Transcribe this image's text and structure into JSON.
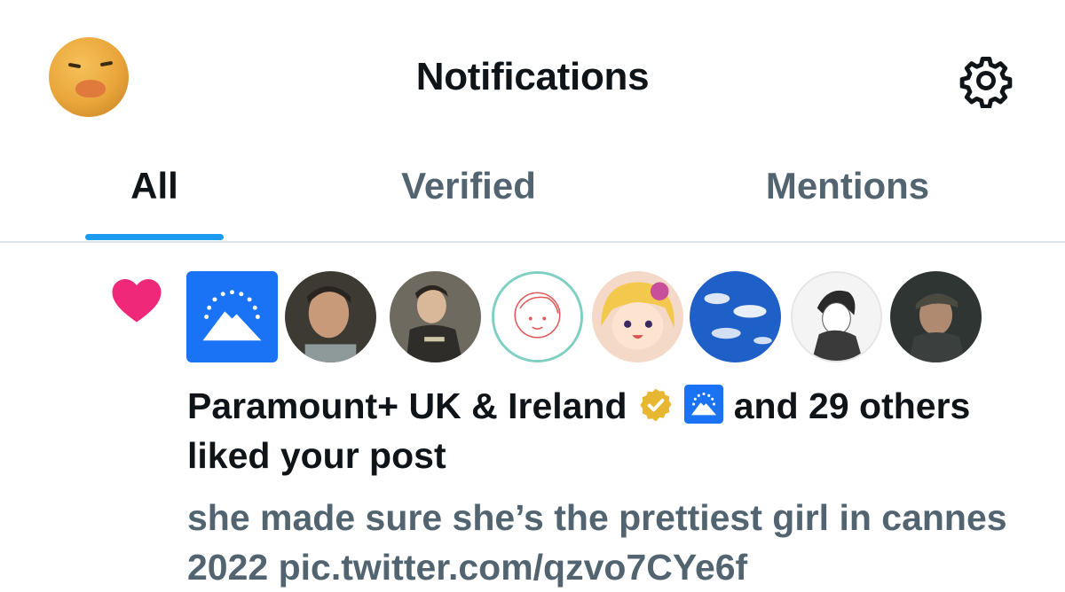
{
  "header": {
    "title": "Notifications",
    "avatar_icon": "duck-avatar-icon",
    "settings_icon": "gear-icon"
  },
  "tabs": [
    {
      "label": "All",
      "active": true
    },
    {
      "label": "Verified",
      "active": false
    },
    {
      "label": "Mentions",
      "active": false
    }
  ],
  "accent_color": "#1d9bf0",
  "notification": {
    "type_icon": "heart-icon",
    "heart_color": "#f0287a",
    "actor_name": "Paramount+ UK & Ireland",
    "verified_badge_color": "#e8b731",
    "affiliate_icon": "paramount-logo-icon",
    "rest_text": "and 29 others liked your post",
    "post_text": "she made sure she’s the prettiest girl in cannes 2022 pic.twitter.com/qzvo7CYe6f",
    "likers": [
      "paramount-logo-avatar",
      "man-portrait-avatar",
      "young-man-hoodie-avatar",
      "sketch-drawing-avatar",
      "anime-girl-avatar",
      "blue-sky-clouds-avatar",
      "manga-character-avatar",
      "man-cap-avatar"
    ]
  }
}
